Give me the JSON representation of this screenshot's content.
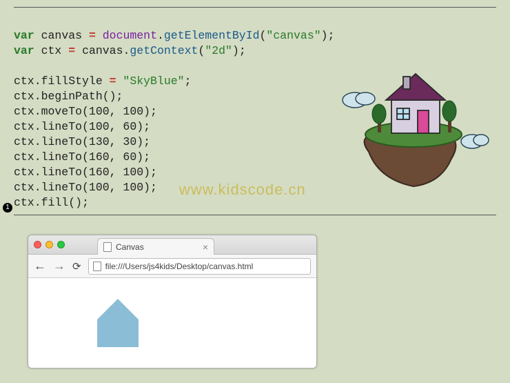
{
  "code": {
    "line1_var": "var",
    "line1_canvas": "canvas",
    "line1_eq": "=",
    "line1_document": "document",
    "line1_dot1": ".",
    "line1_getElementById": "getElementById",
    "line1_open": "(",
    "line1_arg": "\"canvas\"",
    "line1_close": ");",
    "line2_var": "var",
    "line2_ctx": "ctx",
    "line2_eq": "=",
    "line2_canvas": "canvas",
    "line2_dot": ".",
    "line2_getContext": "getContext",
    "line2_open": "(",
    "line2_arg": "\"2d\"",
    "line2_close": ");",
    "line4": "ctx.fillStyle ",
    "line4_eq": "=",
    "line4_val": " \"SkyBlue\"",
    "line4_semi": ";",
    "line5": "ctx.beginPath();",
    "line6": "ctx.moveTo(100, 100);",
    "line7": "ctx.lineTo(100, 60);",
    "line8": "ctx.lineTo(130, 30);",
    "line9": "ctx.lineTo(160, 60);",
    "line10": "ctx.lineTo(160, 100);",
    "line11": "ctx.lineTo(100, 100);",
    "line12": "ctx.fill();"
  },
  "callout": "1",
  "watermark": "www.kidscode.cn",
  "browser": {
    "tab_title": "Canvas",
    "tab_close": "×",
    "nav_back": "←",
    "nav_forward": "→",
    "nav_reload": "⟳",
    "url": "file:///Users/js4kids/Desktop/canvas.html"
  }
}
